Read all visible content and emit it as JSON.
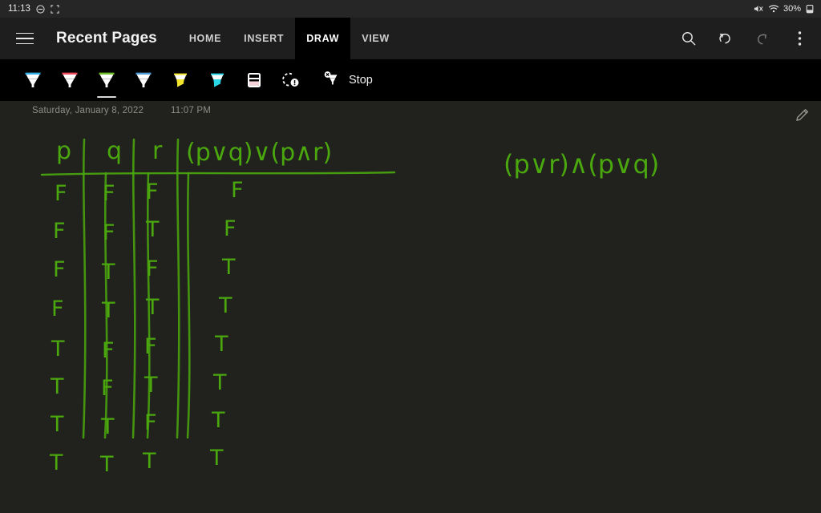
{
  "status_bar": {
    "time": "11:13",
    "left_icons": [
      "do-not-disturb-icon",
      "screenshot-crop-icon"
    ],
    "right_icons": [
      "volume-mute-icon",
      "wifi-icon",
      "battery-icon"
    ],
    "battery_percent": "30%"
  },
  "app_bar": {
    "menu_icon": "hamburger-menu-icon",
    "title": "Recent Pages",
    "tabs": [
      {
        "label": "HOME",
        "active": false
      },
      {
        "label": "INSERT",
        "active": false
      },
      {
        "label": "DRAW",
        "active": true
      },
      {
        "label": "VIEW",
        "active": false
      }
    ],
    "actions": [
      {
        "name": "search-icon",
        "enabled": true
      },
      {
        "name": "undo-icon",
        "enabled": true
      },
      {
        "name": "redo-icon",
        "enabled": false
      },
      {
        "name": "overflow-menu-icon",
        "enabled": true
      }
    ]
  },
  "draw_toolbar": {
    "tools": [
      {
        "name": "pen-blue",
        "type": "pen",
        "color": "#31b0e8",
        "selected": false
      },
      {
        "name": "pen-red",
        "type": "pen",
        "color": "#f0485c",
        "selected": false
      },
      {
        "name": "pen-green",
        "type": "pen",
        "color": "#6fbf2a",
        "selected": true
      },
      {
        "name": "pen-light-blue",
        "type": "pen",
        "color": "#4e9bd6",
        "selected": false
      },
      {
        "name": "highlighter-yellow",
        "type": "highlighter",
        "color": "#f2e52c",
        "selected": false
      },
      {
        "name": "highlighter-cyan",
        "type": "highlighter",
        "color": "#28d8e8",
        "selected": false
      },
      {
        "name": "eraser",
        "type": "eraser",
        "color": "#f3d3d8",
        "selected": false
      },
      {
        "name": "lasso-select",
        "type": "lasso",
        "color": "#ffffff",
        "selected": false
      }
    ],
    "stop": {
      "icon": "pen-stop-icon",
      "label": "Stop"
    }
  },
  "page": {
    "date": "Saturday, January 8, 2022",
    "time": "11:07 PM",
    "edit_icon": "pencil-edit-icon",
    "ink_color": "#4aa80e",
    "background": "#21211e",
    "handwriting": {
      "table_headers": [
        "p",
        "q",
        "r",
        "(p∨q)∨(p∧r)"
      ],
      "rows": [
        {
          "p": "F",
          "q": "F",
          "r": "F",
          "result": "F"
        },
        {
          "p": "F",
          "q": "F",
          "r": "T",
          "result": "F"
        },
        {
          "p": "F",
          "q": "T",
          "r": "F",
          "result": "T"
        },
        {
          "p": "F",
          "q": "T",
          "r": "T",
          "result": "T"
        },
        {
          "p": "T",
          "q": "F",
          "r": "F",
          "result": "T"
        },
        {
          "p": "T",
          "q": "F",
          "r": "T",
          "result": "T"
        },
        {
          "p": "T",
          "q": "T",
          "r": "F",
          "result": "T"
        },
        {
          "p": "T",
          "q": "T",
          "r": "T",
          "result": "T"
        }
      ],
      "side_expression": "(p∨r)∧(p∨q)"
    }
  }
}
